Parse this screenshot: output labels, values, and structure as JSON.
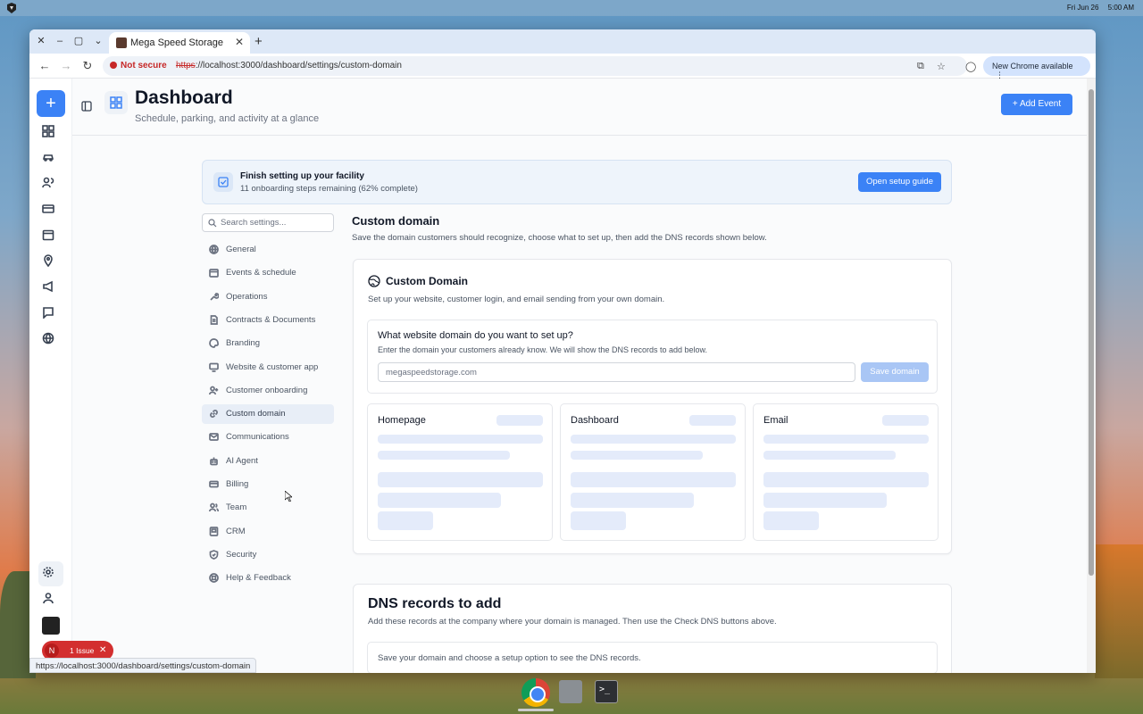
{
  "system": {
    "date": "Fri Jun 26",
    "time": "5:00 AM"
  },
  "browser": {
    "tab_title": "Mega Speed Storage",
    "security": "Not secure",
    "url_scheme": "https",
    "url_rest": "://localhost:3000/dashboard/settings/custom-domain",
    "chrome_update": "New Chrome available",
    "status_url": "https://localhost:3000/dashboard/settings/custom-domain"
  },
  "header": {
    "title": "Dashboard",
    "subtitle": "Schedule, parking, and activity at a glance",
    "add_event": "Add Event"
  },
  "setup_banner": {
    "title": "Finish setting up your facility",
    "detail": "11 onboarding steps remaining (62% complete)",
    "button": "Open setup guide"
  },
  "settings_nav": {
    "search_placeholder": "Search settings...",
    "items": [
      {
        "label": "General",
        "icon": "globe-icon"
      },
      {
        "label": "Events & schedule",
        "icon": "calendar-icon"
      },
      {
        "label": "Operations",
        "icon": "wrench-icon"
      },
      {
        "label": "Contracts & Documents",
        "icon": "document-icon"
      },
      {
        "label": "Branding",
        "icon": "palette-icon"
      },
      {
        "label": "Website & customer app",
        "icon": "monitor-icon"
      },
      {
        "label": "Customer onboarding",
        "icon": "user-plus-icon"
      },
      {
        "label": "Custom domain",
        "icon": "link-icon"
      },
      {
        "label": "Communications",
        "icon": "mail-icon"
      },
      {
        "label": "AI Agent",
        "icon": "robot-icon"
      },
      {
        "label": "Billing",
        "icon": "card-icon"
      },
      {
        "label": "Team",
        "icon": "users-icon"
      },
      {
        "label": "CRM",
        "icon": "crm-icon"
      },
      {
        "label": "Security",
        "icon": "shield-icon"
      },
      {
        "label": "Help & Feedback",
        "icon": "help-icon"
      }
    ]
  },
  "custom_domain": {
    "section_title": "Custom domain",
    "section_desc": "Save the domain customers should recognize, choose what to set up, then add the DNS records shown below.",
    "card_title": "Custom Domain",
    "card_desc": "Set up your website, customer login, and email sending from your own domain.",
    "question": "What website domain do you want to set up?",
    "hint": "Enter the domain your customers already know. We will show the DNS records to add below.",
    "input_placeholder": "megaspeedstorage.com",
    "save_button": "Save domain",
    "options": [
      "Homepage",
      "Dashboard",
      "Email"
    ]
  },
  "dns": {
    "title": "DNS records to add",
    "desc": "Add these records at the company where your domain is managed. Then use the Check DNS buttons above.",
    "empty": "Save your domain and choose a setup option to see the DNS records."
  },
  "issue_badge": {
    "letter": "N",
    "label": "1 Issue"
  },
  "colors": {
    "primary": "#3b82f6",
    "skeleton": "#e4ebfa",
    "danger": "#d32f2f"
  }
}
